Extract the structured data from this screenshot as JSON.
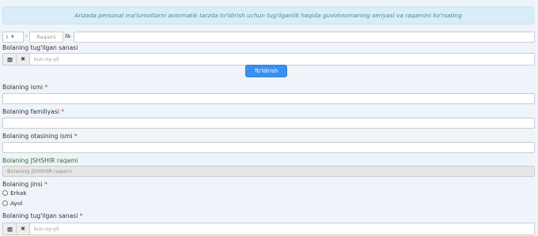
{
  "info_text": "Arizada personal ma'lumotlarni avtomatik tarzda to'ldirish uchun tug'ilganlik haqida guvohnomaning seriyasi va raqamini ko'rsating",
  "certificate": {
    "series_value": "I",
    "dash": "-",
    "number_placeholder": "Raqami",
    "no_symbol": "№"
  },
  "birthdate_top": {
    "label": "Bolaning tug'ilgan sanasi",
    "placeholder": "kun-oy-yil"
  },
  "fill_button": "To'ldirish",
  "first_name": {
    "label": "Bolaning ismi",
    "required": "*"
  },
  "last_name": {
    "label": "Bolaning familiyasi",
    "required": "*"
  },
  "patronymic": {
    "label": "Bolaning otasining ismi",
    "required": "*"
  },
  "pinfl": {
    "label": "Bolaning JSHSHIR raqami",
    "placeholder": "Bolaning JSHSHIR raqami"
  },
  "gender": {
    "label": "Bolaning jinsi",
    "required": "*",
    "options": [
      "Erkak",
      "Ayol"
    ]
  },
  "birthdate_bottom": {
    "label": "Bolaning tug'ilgan sanasi",
    "required": "*",
    "placeholder": "kun-oy-yil"
  },
  "icons": {
    "calendar": "calendar-icon",
    "clear": "clear-icon"
  }
}
